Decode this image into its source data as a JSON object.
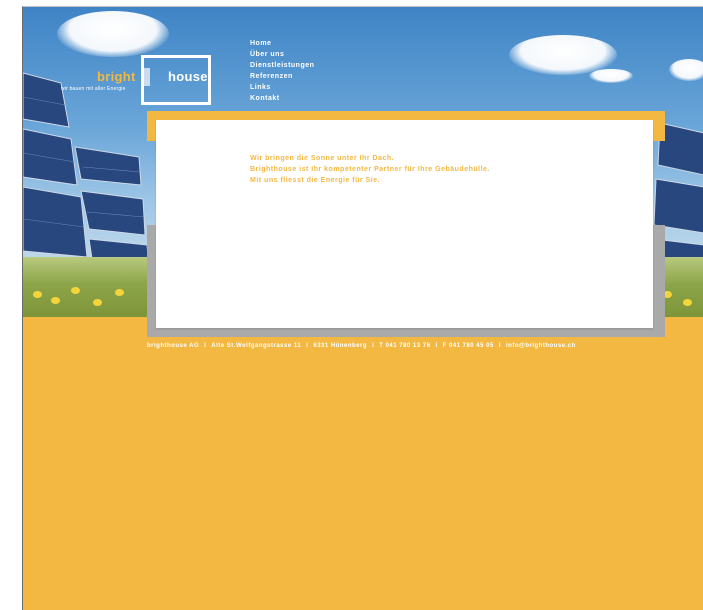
{
  "logo": {
    "brand_left": "bright",
    "brand_right": "house",
    "tagline": "wir bauen mit aller Energie"
  },
  "nav": {
    "items": [
      {
        "label": "Home"
      },
      {
        "label": "Über uns"
      },
      {
        "label": "Dienstleistungen"
      },
      {
        "label": "Referenzen"
      },
      {
        "label": "Links"
      },
      {
        "label": "Kontakt"
      }
    ]
  },
  "intro": {
    "line1": "Wir bringen die Sonne unter Ihr Dach.",
    "line2": "Brighthouse ist Ihr kompetenter Partner für Ihre Gebäudehülle.",
    "line3": "Mit uns fliesst die Energie für Sie."
  },
  "footer": {
    "company": "brighthouse AG",
    "address": "Alte St.Wolfgangstrasse 11",
    "city": "6331 Hünenberg",
    "phone": "T 041 780 13 76",
    "fax": "F 041 780 45 05",
    "email": "info@brighthouse.ch",
    "separator": "I"
  },
  "colors": {
    "accent": "#F3B841",
    "panel": "#FFFFFF",
    "shadow": "#A9A9A9",
    "sky": "#69A5D8"
  }
}
